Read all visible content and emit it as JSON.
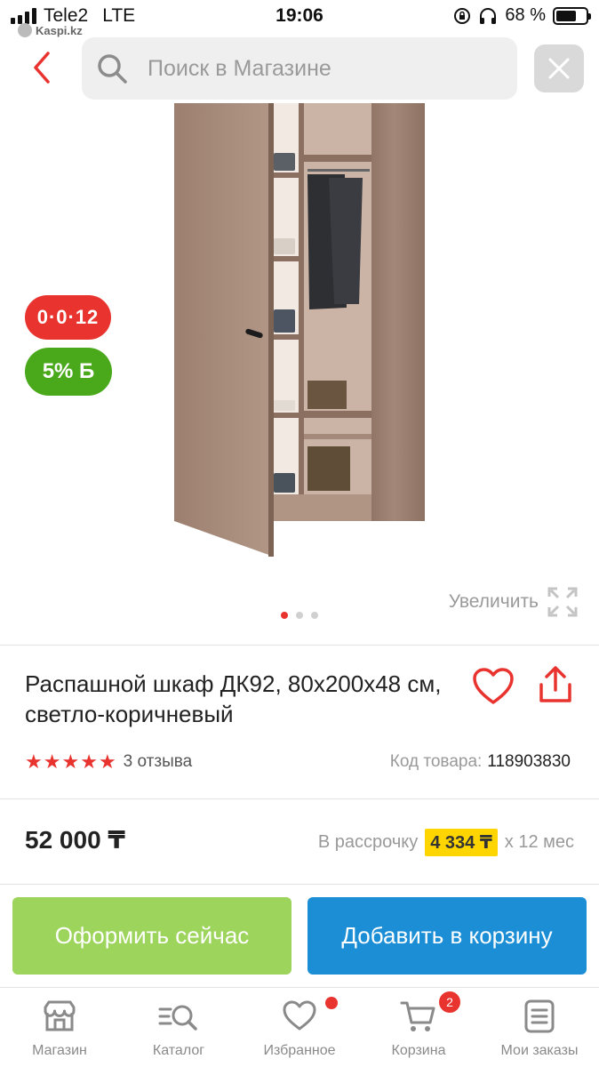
{
  "status_bar": {
    "carrier": "Tele2",
    "network": "LTE",
    "time": "19:06",
    "battery": "68 %",
    "battery_level": 0.68,
    "back_app": "Kaspi.kz"
  },
  "search": {
    "placeholder": "Поиск в Магазине"
  },
  "gallery": {
    "installment_badge": "0·0·12",
    "bonus_badge": "5% Б",
    "zoom_label": "Увеличить",
    "image_count": 3,
    "active_image": 1
  },
  "product": {
    "title": "Распашной шкаф ДК92, 80x200x48 см, светло-коричневый",
    "rating": 5,
    "reviews": "3 отзыва",
    "sku_label": "Код товара:",
    "sku": "118903830",
    "price": "52 000 ₸",
    "installment_label": "В рассрочку",
    "installment_amount": "4 334 ₸",
    "installment_term": "х 12 мес"
  },
  "actions": {
    "buy_now": "Оформить сейчас",
    "add_to_cart": "Добавить в корзину"
  },
  "tabbar": {
    "items": [
      {
        "label": "Магазин",
        "icon": "shop-icon"
      },
      {
        "label": "Каталог",
        "icon": "catalog-search-icon"
      },
      {
        "label": "Избранное",
        "icon": "heart-icon"
      },
      {
        "label": "Корзина",
        "icon": "cart-icon"
      },
      {
        "label": "Мои заказы",
        "icon": "orders-icon"
      }
    ],
    "cart_count": "2"
  },
  "colors": {
    "accent_red": "#e8332f",
    "green": "#4aa81b",
    "buy_button": "#9dd45c",
    "cart_button": "#1b8ed6",
    "installment_highlight": "#ffd500"
  }
}
